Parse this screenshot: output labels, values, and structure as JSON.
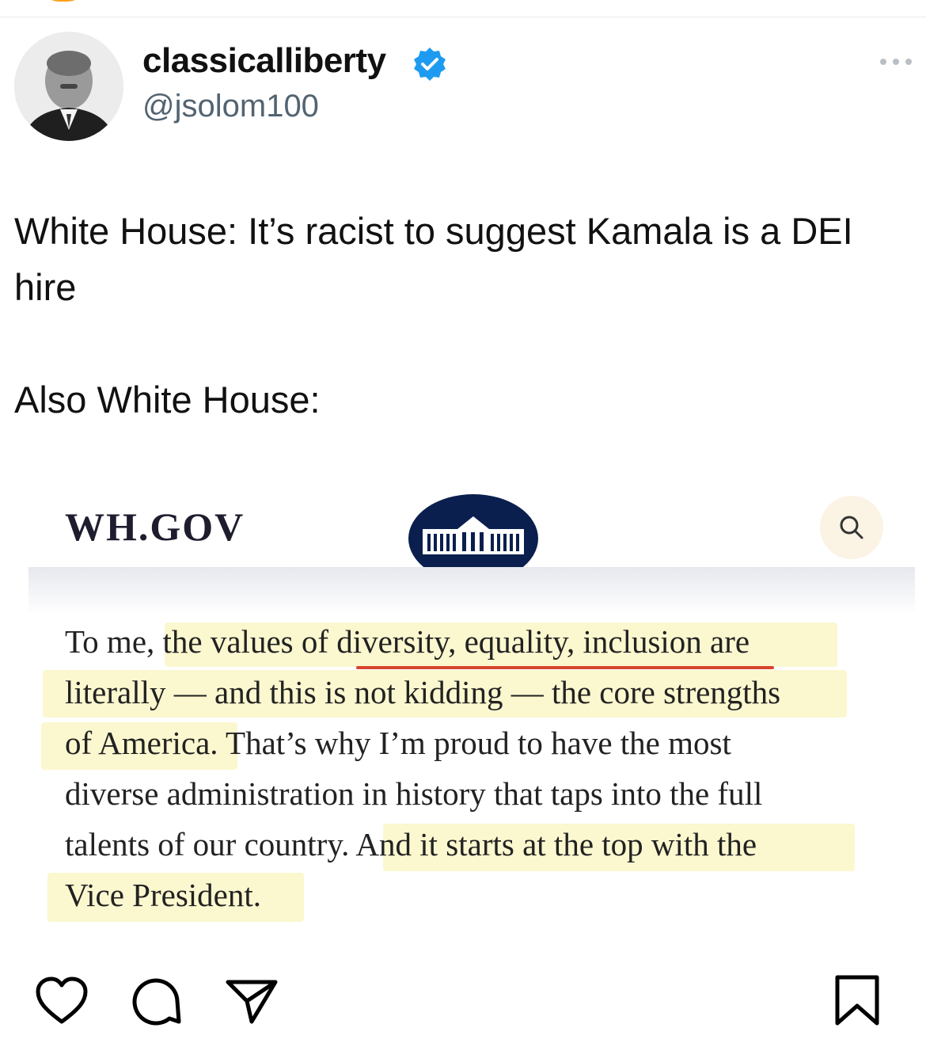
{
  "post": {
    "username": "classicalliberty",
    "handle": "@jsolom100",
    "text_lines": [
      "White House: It’s racist to suggest Kamala is a DEI hire",
      "Also White House:"
    ]
  },
  "embed": {
    "site_logo": "WH.GOV",
    "quote_lines": [
      "To me, the values of diversity, equality, inclusion are",
      "literally — and this is not kidding — the core strengths",
      "of America. That’s why I’m proud to have the most",
      "diverse administration in history that taps into the full",
      "talents of our country. And it starts at the top with the",
      "Vice President."
    ]
  },
  "icons": {
    "verified": "verified-badge-icon",
    "more": "more-options-icon",
    "search": "search-icon",
    "like": "heart-icon",
    "comment": "comment-icon",
    "share": "send-icon",
    "save": "bookmark-icon"
  },
  "colors": {
    "verified_blue": "#1d9bf0",
    "handle_gray": "#536471",
    "highlight": "#fbf7cf",
    "underline_red": "#d7452e",
    "seal_navy": "#0a1f4e"
  }
}
